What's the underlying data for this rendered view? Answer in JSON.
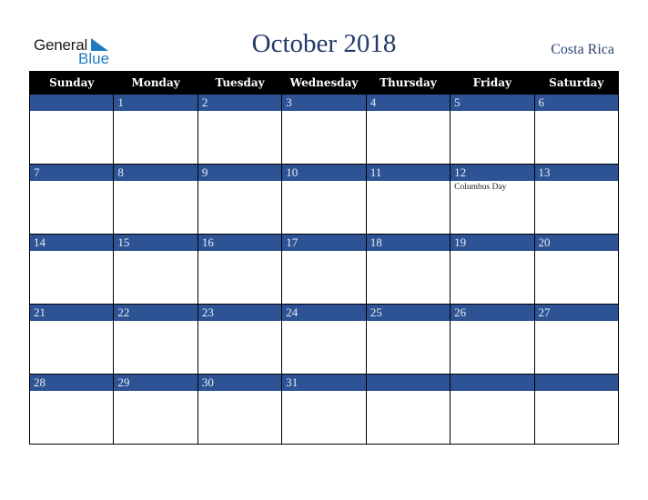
{
  "logo": {
    "line1": "General",
    "line2": "Blue"
  },
  "header": {
    "title": "October 2018",
    "country": "Costa Rica"
  },
  "colors": {
    "header_bg": "#000000",
    "day_band": "#2d5394",
    "title": "#233a6b",
    "logo_blue": "#1f7bc1"
  },
  "weekdays": [
    "Sunday",
    "Monday",
    "Tuesday",
    "Wednesday",
    "Thursday",
    "Friday",
    "Saturday"
  ],
  "weeks": [
    [
      {
        "day": ""
      },
      {
        "day": "1"
      },
      {
        "day": "2"
      },
      {
        "day": "3"
      },
      {
        "day": "4"
      },
      {
        "day": "5"
      },
      {
        "day": "6"
      }
    ],
    [
      {
        "day": "7"
      },
      {
        "day": "8"
      },
      {
        "day": "9"
      },
      {
        "day": "10"
      },
      {
        "day": "11"
      },
      {
        "day": "12",
        "event": "Columbus Day"
      },
      {
        "day": "13"
      }
    ],
    [
      {
        "day": "14"
      },
      {
        "day": "15"
      },
      {
        "day": "16"
      },
      {
        "day": "17"
      },
      {
        "day": "18"
      },
      {
        "day": "19"
      },
      {
        "day": "20"
      }
    ],
    [
      {
        "day": "21"
      },
      {
        "day": "22"
      },
      {
        "day": "23"
      },
      {
        "day": "24"
      },
      {
        "day": "25"
      },
      {
        "day": "26"
      },
      {
        "day": "27"
      }
    ],
    [
      {
        "day": "28"
      },
      {
        "day": "29"
      },
      {
        "day": "30"
      },
      {
        "day": "31"
      },
      {
        "day": ""
      },
      {
        "day": ""
      },
      {
        "day": ""
      }
    ]
  ]
}
